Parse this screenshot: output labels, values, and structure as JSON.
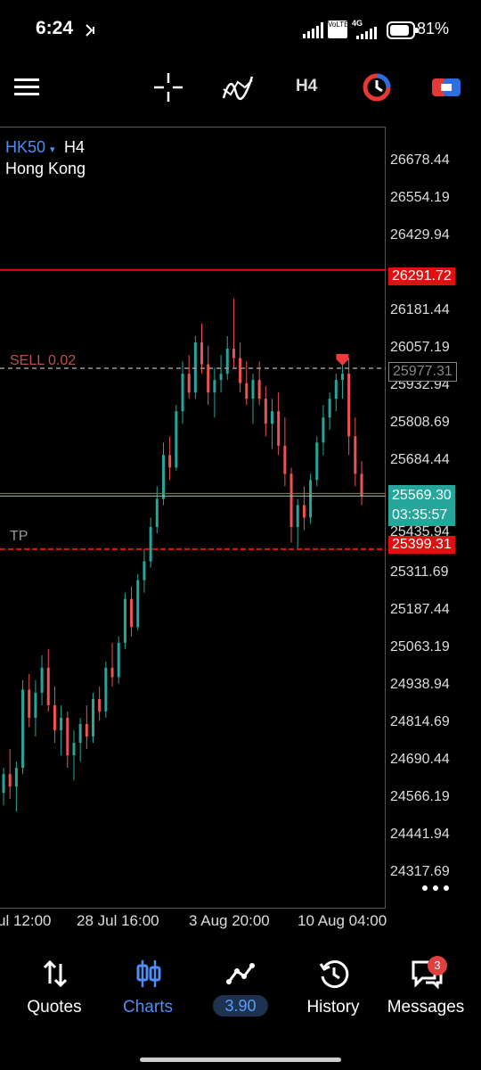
{
  "status_bar": {
    "time": "6:24",
    "battery": "81%",
    "network": "4G",
    "volte": "VoLTE"
  },
  "toolbar": {
    "timeframe": "H4",
    "icons": [
      "menu-icon",
      "crosshair-icon",
      "indicator-icon",
      "timeframe",
      "trade-clock-icon",
      "toggle-panel-icon"
    ]
  },
  "chart": {
    "symbol": "HK50",
    "symbol_marker": "▾",
    "timeframe": "H4",
    "description": "Hong Kong",
    "sell_label": "SELL 0.02",
    "tp_label": "TP",
    "sell_price_tag": "25977.31",
    "resistance_tag": "26291.72",
    "current_price": "25569.30",
    "countdown": "03:35:57",
    "tp_price_tag": "25399.31",
    "partial_tick_under_tag": "25435.94",
    "y_ticks": [
      "26678.44",
      "26554.19",
      "26429.94",
      "26181.44",
      "26057.19",
      "25932.94",
      "25808.69",
      "25684.44",
      "25311.69",
      "25187.44",
      "25063.19",
      "24938.94",
      "24814.69",
      "24690.44",
      "24566.19",
      "24441.94",
      "24317.69"
    ],
    "x_ticks": [
      "ul 12:00",
      "28 Jul 16:00",
      "3 Aug 20:00",
      "10 Aug 04:00"
    ],
    "colors": {
      "bull": "#26a69a",
      "bear": "#ef5350",
      "line_red": "#e01010"
    }
  },
  "chart_data": {
    "type": "candlestick",
    "symbol": "HK50",
    "ylim": [
      24250,
      26750
    ],
    "candles": [
      [
        24620,
        24700,
        24580,
        24680
      ],
      [
        24680,
        24760,
        24600,
        24640
      ],
      [
        24640,
        24720,
        24560,
        24700
      ],
      [
        24700,
        24980,
        24680,
        24950
      ],
      [
        24950,
        25000,
        24830,
        24860
      ],
      [
        24860,
        24980,
        24800,
        24940
      ],
      [
        24940,
        25060,
        24900,
        25020
      ],
      [
        25020,
        25080,
        24880,
        24900
      ],
      [
        24900,
        24960,
        24780,
        24820
      ],
      [
        24820,
        24900,
        24740,
        24860
      ],
      [
        24860,
        24880,
        24700,
        24740
      ],
      [
        24740,
        24820,
        24660,
        24780
      ],
      [
        24780,
        24860,
        24720,
        24840
      ],
      [
        24840,
        24900,
        24760,
        24800
      ],
      [
        24800,
        24940,
        24780,
        24920
      ],
      [
        24920,
        24960,
        24850,
        24880
      ],
      [
        24880,
        25040,
        24860,
        25020
      ],
      [
        25020,
        25100,
        24960,
        24990
      ],
      [
        24990,
        25120,
        24970,
        25100
      ],
      [
        25100,
        25260,
        25080,
        25240
      ],
      [
        25240,
        25280,
        25120,
        25150
      ],
      [
        25150,
        25320,
        25140,
        25300
      ],
      [
        25300,
        25400,
        25260,
        25360
      ],
      [
        25360,
        25500,
        25340,
        25470
      ],
      [
        25470,
        25600,
        25450,
        25560
      ],
      [
        25560,
        25740,
        25540,
        25700
      ],
      [
        25700,
        25760,
        25620,
        25660
      ],
      [
        25660,
        25860,
        25650,
        25840
      ],
      [
        25840,
        26000,
        25800,
        25960
      ],
      [
        25960,
        26020,
        25880,
        25900
      ],
      [
        25900,
        26080,
        25880,
        26060
      ],
      [
        26060,
        26120,
        25960,
        25990
      ],
      [
        25990,
        26050,
        25860,
        25900
      ],
      [
        25900,
        25980,
        25820,
        25940
      ],
      [
        25940,
        26020,
        25900,
        25960
      ],
      [
        25960,
        26080,
        25940,
        26040
      ],
      [
        26040,
        26200,
        25980,
        26010
      ],
      [
        26010,
        26060,
        25900,
        25930
      ],
      [
        25930,
        26000,
        25860,
        25880
      ],
      [
        25880,
        25960,
        25800,
        25940
      ],
      [
        25940,
        26000,
        25860,
        25880
      ],
      [
        25880,
        25920,
        25760,
        25800
      ],
      [
        25800,
        25880,
        25720,
        25840
      ],
      [
        25840,
        25900,
        25700,
        25730
      ],
      [
        25730,
        25820,
        25600,
        25640
      ],
      [
        25640,
        25660,
        25420,
        25470
      ],
      [
        25470,
        25560,
        25400,
        25540
      ],
      [
        25540,
        25600,
        25460,
        25500
      ],
      [
        25500,
        25640,
        25480,
        25620
      ],
      [
        25620,
        25760,
        25600,
        25740
      ],
      [
        25740,
        25860,
        25700,
        25820
      ],
      [
        25820,
        25900,
        25780,
        25880
      ],
      [
        25880,
        25960,
        25840,
        25940
      ],
      [
        25940,
        25990,
        25880,
        25960
      ],
      [
        25960,
        26010,
        25700,
        25760
      ],
      [
        25760,
        25820,
        25600,
        25640
      ],
      [
        25640,
        25680,
        25540,
        25569
      ]
    ],
    "lines": {
      "resistance": 26291.72,
      "sell": 25977.31,
      "current": 25569.3,
      "tp": 25399.31
    }
  },
  "bottom_nav": {
    "items": [
      {
        "label": "Quotes",
        "icon": "quotes-arrows-icon",
        "active": false
      },
      {
        "label": "Charts",
        "icon": "charts-candles-icon",
        "active": true
      },
      {
        "label": "3.90",
        "icon": "trade-line-icon",
        "active": false
      },
      {
        "label": "History",
        "icon": "history-clock-icon",
        "active": false
      },
      {
        "label": "Messages",
        "icon": "messages-icon",
        "active": false
      }
    ],
    "messages_badge": "3"
  }
}
